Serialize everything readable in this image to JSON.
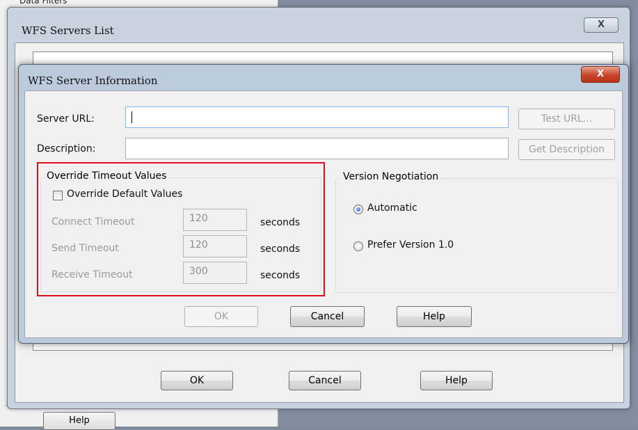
{
  "background": {
    "top_label": "Data Filters",
    "help_label": "Help"
  },
  "servers_list": {
    "title": "WFS Servers List",
    "close_glyph": "X",
    "buttons": {
      "ok": "OK",
      "cancel": "Cancel",
      "help": "Help"
    }
  },
  "server_info": {
    "title": "WFS Server Information",
    "close_glyph": "X",
    "server_url": {
      "label": "Server URL:",
      "value": ""
    },
    "description": {
      "label": "Description:",
      "value": ""
    },
    "test_url_button": "Test URL...",
    "get_description_button": "Get Description",
    "override_group": {
      "legend": "Override Timeout Values",
      "checkbox_label": "Override Default Values",
      "checked": false,
      "rows": [
        {
          "label": "Connect Timeout",
          "value": "120",
          "unit": "seconds"
        },
        {
          "label": "Send Timeout",
          "value": "120",
          "unit": "seconds"
        },
        {
          "label": "Receive Timeout",
          "value": "300",
          "unit": "seconds"
        }
      ]
    },
    "version_group": {
      "legend": "Version Negotiation",
      "options": [
        {
          "label": "Automatic",
          "selected": true
        },
        {
          "label": "Prefer Version 1.0",
          "selected": false
        }
      ]
    },
    "buttons": {
      "ok": "OK",
      "cancel": "Cancel",
      "help": "Help"
    }
  },
  "colors": {
    "highlight": "#e0101a",
    "dialog_frame": "#bccbdc",
    "close_red": "#c8432a"
  }
}
